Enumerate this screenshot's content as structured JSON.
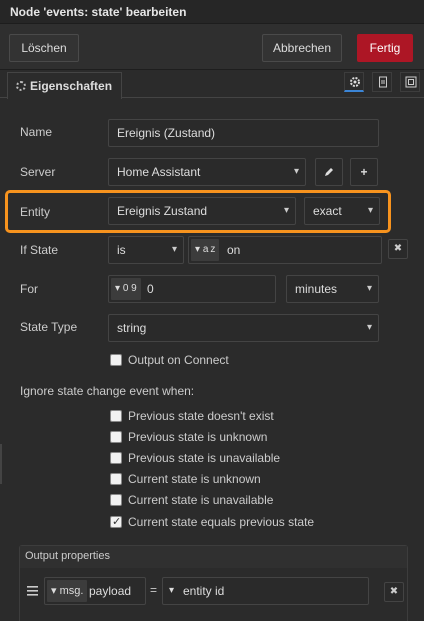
{
  "dialog": {
    "title": "Node 'events: state' bearbeiten"
  },
  "toolbar": {
    "delete_label": "Löschen",
    "cancel_label": "Abbrechen",
    "done_label": "Fertig"
  },
  "tabs": {
    "properties_label": "Eigenschaften"
  },
  "form": {
    "name": {
      "label": "Name",
      "value": "Ereignis (Zustand)"
    },
    "server": {
      "label": "Server",
      "value": "Home Assistant",
      "edit_icon": "pencil-icon",
      "add_icon": "plus-icon"
    },
    "entity": {
      "label": "Entity",
      "value": "Ereignis Zustand",
      "match": "exact"
    },
    "if_state": {
      "label": "If State",
      "operator": "is",
      "type_glyph": "a z",
      "value": "on"
    },
    "for": {
      "label": "For",
      "type_glyph": "0 9",
      "value": "0",
      "unit": "minutes"
    },
    "state_type": {
      "label": "State Type",
      "value": "string"
    },
    "output_on_connect": {
      "label": "Output on Connect",
      "checked": false
    },
    "ignore": {
      "heading": "Ignore state change event when:",
      "options": [
        {
          "label": "Previous state doesn't exist",
          "checked": false
        },
        {
          "label": "Previous state is unknown",
          "checked": false
        },
        {
          "label": "Previous state is unavailable",
          "checked": false
        },
        {
          "label": "Current state is unknown",
          "checked": false
        },
        {
          "label": "Current state is unavailable",
          "checked": false
        },
        {
          "label": "Current state equals previous state",
          "checked": true
        }
      ]
    },
    "output_properties": {
      "heading": "Output properties",
      "row": {
        "prefix": "msg.",
        "property": "payload",
        "equals": "=",
        "value": "entity id"
      }
    }
  },
  "colors": {
    "accent": "#ad1625",
    "highlight": "#f7931e",
    "tab_selected": "#3b85d6"
  }
}
